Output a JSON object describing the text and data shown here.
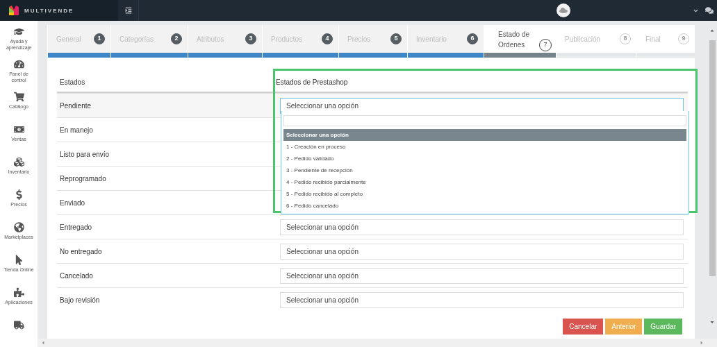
{
  "brand": "MULTIVENDE",
  "sidebar": {
    "items": [
      {
        "label": "Ayuda y aprendizaje"
      },
      {
        "label": "Panel de control"
      },
      {
        "label": "Catálogo"
      },
      {
        "label": "Ventas"
      },
      {
        "label": "Inventario"
      },
      {
        "label": "Precios"
      },
      {
        "label": "Marketplaces"
      },
      {
        "label": "Tienda Online"
      },
      {
        "label": "Aplicaciones"
      }
    ]
  },
  "steps": [
    {
      "label": "General",
      "number": "1",
      "done": true,
      "selected": false
    },
    {
      "label": "Categorías",
      "number": "2",
      "done": true,
      "selected": false
    },
    {
      "label": "Atributos",
      "number": "3",
      "done": true,
      "selected": false
    },
    {
      "label": "Productos",
      "number": "4",
      "done": true,
      "selected": false
    },
    {
      "label": "Precios",
      "number": "5",
      "done": true,
      "selected": false
    },
    {
      "label": "Inventario",
      "number": "6",
      "done": true,
      "selected": false
    },
    {
      "label": "Estado de Ordenes",
      "number": "7",
      "done": false,
      "selected": true
    },
    {
      "label": "Publicación",
      "number": "8",
      "done": false,
      "selected": false
    },
    {
      "label": "Final",
      "number": "9",
      "done": false,
      "selected": false
    }
  ],
  "table": {
    "columns": [
      "Estados",
      "Estados de Prestashop"
    ],
    "rows": [
      {
        "state": "Pendiente",
        "select": {
          "value": "Seleccionar una opción",
          "expanded": true
        }
      },
      {
        "state": "En manejo"
      },
      {
        "state": "Listo para envío"
      },
      {
        "state": "Reprogramado"
      },
      {
        "state": "Enviado"
      },
      {
        "state": "Entregado",
        "select": {
          "value": "Seleccionar una opción",
          "expanded": false
        }
      },
      {
        "state": "No entregado",
        "select": {
          "value": "Seleccionar una opción",
          "expanded": false
        }
      },
      {
        "state": "Cancelado",
        "select": {
          "value": "Seleccionar una opción",
          "expanded": false
        }
      },
      {
        "state": "Bajo revisión",
        "select": {
          "value": "Seleccionar una opción",
          "expanded": false
        }
      }
    ]
  },
  "dropdown": {
    "options": [
      {
        "label": "Seleccionar una opción",
        "selected": true
      },
      {
        "label": "1 - Creación en proceso",
        "selected": false
      },
      {
        "label": "2 - Pedido validado",
        "selected": false
      },
      {
        "label": "3 - Pendiente de recepción",
        "selected": false
      },
      {
        "label": "4 - Pedido recibido parcialmente",
        "selected": false
      },
      {
        "label": "5 - Pedido recibido al completo",
        "selected": false
      },
      {
        "label": "6 - Pedido cancelado",
        "selected": false
      }
    ]
  },
  "buttons": [
    {
      "label": "Cancelar",
      "kind": "danger"
    },
    {
      "label": "Anterior",
      "kind": "warning"
    },
    {
      "label": "Guardar",
      "kind": "success"
    }
  ]
}
